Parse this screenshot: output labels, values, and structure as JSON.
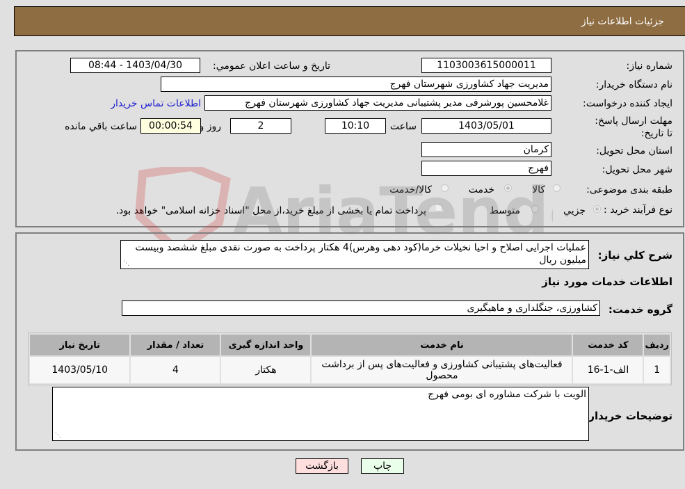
{
  "header": {
    "title": "جزئيات اطلاعات نیاز"
  },
  "form": {
    "need_number": {
      "label": "شماره نیاز:",
      "value": "1103003615000011"
    },
    "announce_datetime": {
      "label": "تاریخ و ساعت اعلان عمومي:",
      "value": "1403/04/30 - 08:44"
    },
    "buyer_org": {
      "label": "نام دستگاه خریدار:",
      "value": "مدیریت جهاد کشاورزی شهرستان فهرج"
    },
    "requester": {
      "label": "ایجاد کننده درخواست:",
      "value": "غلامحسین پورشرفی مدیر پشتیبانی مدیریت جهاد کشاورزی شهرستان فهرج"
    },
    "buyer_contact_link": "اطلاعات تماس خریدار",
    "deadline": {
      "label": "مهلت ارسال پاسخ: تا تاریخ:",
      "date": "1403/05/01",
      "time_label": "ساعت",
      "time": "10:10",
      "days": "2",
      "days_label": "روز و",
      "remaining": "00:00:54",
      "remaining_label": "ساعت باقي مانده"
    },
    "province": {
      "label": "استان محل تحویل:",
      "value": "کرمان"
    },
    "city": {
      "label": "شهر محل تحویل:",
      "value": "فهرج"
    },
    "category": {
      "label": "طبقه بندی موضوعی:",
      "options": [
        "کالا",
        "خدمت",
        "کالا/خدمت"
      ],
      "selected": "خدمت"
    },
    "purchase_process": {
      "label": "نوع فرآیند خرید :",
      "options": [
        "جزيي",
        "متوسط"
      ],
      "selected": "جزيي",
      "treasury_checkbox_label": "پرداخت تمام یا بخشی از مبلغ خرید،از محل \"اسناد خزانه اسلامی\" خواهد بود.",
      "treasury_checked": false
    }
  },
  "details": {
    "description_label": "شرح کلي نیاز:",
    "description": "عملیات اجرایی اصلاح و احیا نخیلات خرما(کود دهی وهرس)4 هکتار پرداخت به صورت نقدی مبلغ ششصد وبیست میلیون ریال",
    "services_title": "اطلاعات خدمات مورد نیاز",
    "service_group_label": "گروه خدمت:",
    "service_group": "کشاورزی، جنگلداری و ماهیگیری",
    "table": {
      "headers": [
        "ردیف",
        "کد خدمت",
        "نام خدمت",
        "واحد اندازه گیری",
        "تعداد / مقدار",
        "تاریخ نیاز"
      ],
      "rows": [
        [
          "1",
          "الف-1-16",
          "فعالیت‌های پشتیبانی کشاورزی و فعالیت‌های پس از برداشت محصول",
          "هکتار",
          "4",
          "1403/05/10"
        ]
      ]
    },
    "buyer_notes_label": "توضیحات خریدار:",
    "buyer_notes": "الویت با شرکت مشاوره ای بومی فهرج"
  },
  "buttons": {
    "print": "چاپ",
    "back": "بازگشت"
  },
  "colors": {
    "header_bg": "#8e6d43",
    "print_bg": "#eaffea",
    "back_bg": "#ffdede",
    "link": "#2020d0"
  },
  "watermark": "AriaTender.neT"
}
